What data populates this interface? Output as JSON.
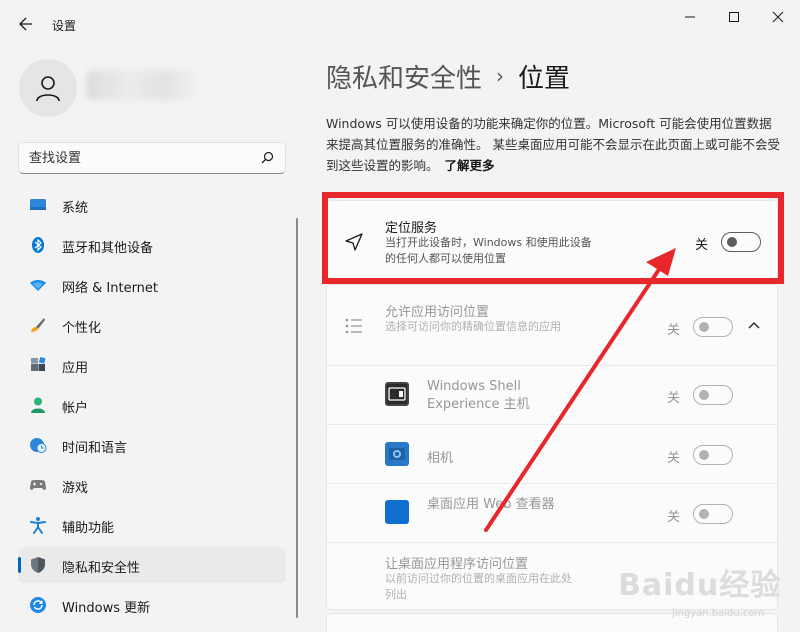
{
  "window": {
    "title": "设置"
  },
  "sidebar": {
    "search": {
      "placeholder": "查找设置",
      "value": ""
    },
    "items": [
      {
        "label": "系统",
        "icon": "system-icon"
      },
      {
        "label": "蓝牙和其他设备",
        "icon": "bluetooth-icon"
      },
      {
        "label": "网络 & Internet",
        "icon": "wifi-icon"
      },
      {
        "label": "个性化",
        "icon": "brush-icon"
      },
      {
        "label": "应用",
        "icon": "apps-icon"
      },
      {
        "label": "帐户",
        "icon": "account-icon"
      },
      {
        "label": "时间和语言",
        "icon": "clock-globe-icon"
      },
      {
        "label": "游戏",
        "icon": "gamepad-icon"
      },
      {
        "label": "辅助功能",
        "icon": "accessibility-icon"
      },
      {
        "label": "隐私和安全性",
        "icon": "shield-icon",
        "active": true
      },
      {
        "label": "Windows 更新",
        "icon": "update-icon"
      }
    ]
  },
  "main": {
    "breadcrumb": {
      "parent": "隐私和安全性",
      "separator": "›",
      "current": "位置"
    },
    "description": "Windows 可以使用设备的功能来确定你的位置。Microsoft 可能会使用位置数据来提高其位置服务的准确性。 某些桌面应用可能不会显示在此页面上或可能不会受到这些设置的影响。",
    "learn_more": "了解更多",
    "location_service": {
      "title": "定位服务",
      "subtitle": "当打开此设备时，Windows 和使用此设备的任何人都可以使用位置",
      "state_label": "关",
      "on": false
    },
    "app_access": {
      "title": "允许应用访问位置",
      "subtitle": "选择可访问你的精确位置信息的应用",
      "state_label": "关",
      "on": false,
      "apps": [
        {
          "name": "Windows Shell Experience 主机",
          "state_label": "关",
          "on": false,
          "icon": "shell-experience-icon"
        },
        {
          "name": "相机",
          "state_label": "关",
          "on": false,
          "icon": "camera-app-icon"
        },
        {
          "name": "桌面应用 Web 查看器",
          "state_label": "关",
          "on": false,
          "icon": "web-viewer-icon"
        }
      ],
      "desktop_apps": {
        "title": "让桌面应用程序访问位置",
        "subtitle": "以前访问过你的位置的桌面应用在此处列出"
      }
    }
  },
  "watermark": {
    "text": "Baidu经验",
    "sub": "jingyan.baidu.com"
  },
  "colors": {
    "accent": "#0067c0",
    "annotation_red": "#e8272d",
    "background": "#f3f3f3",
    "card": "#fbfbfb"
  }
}
